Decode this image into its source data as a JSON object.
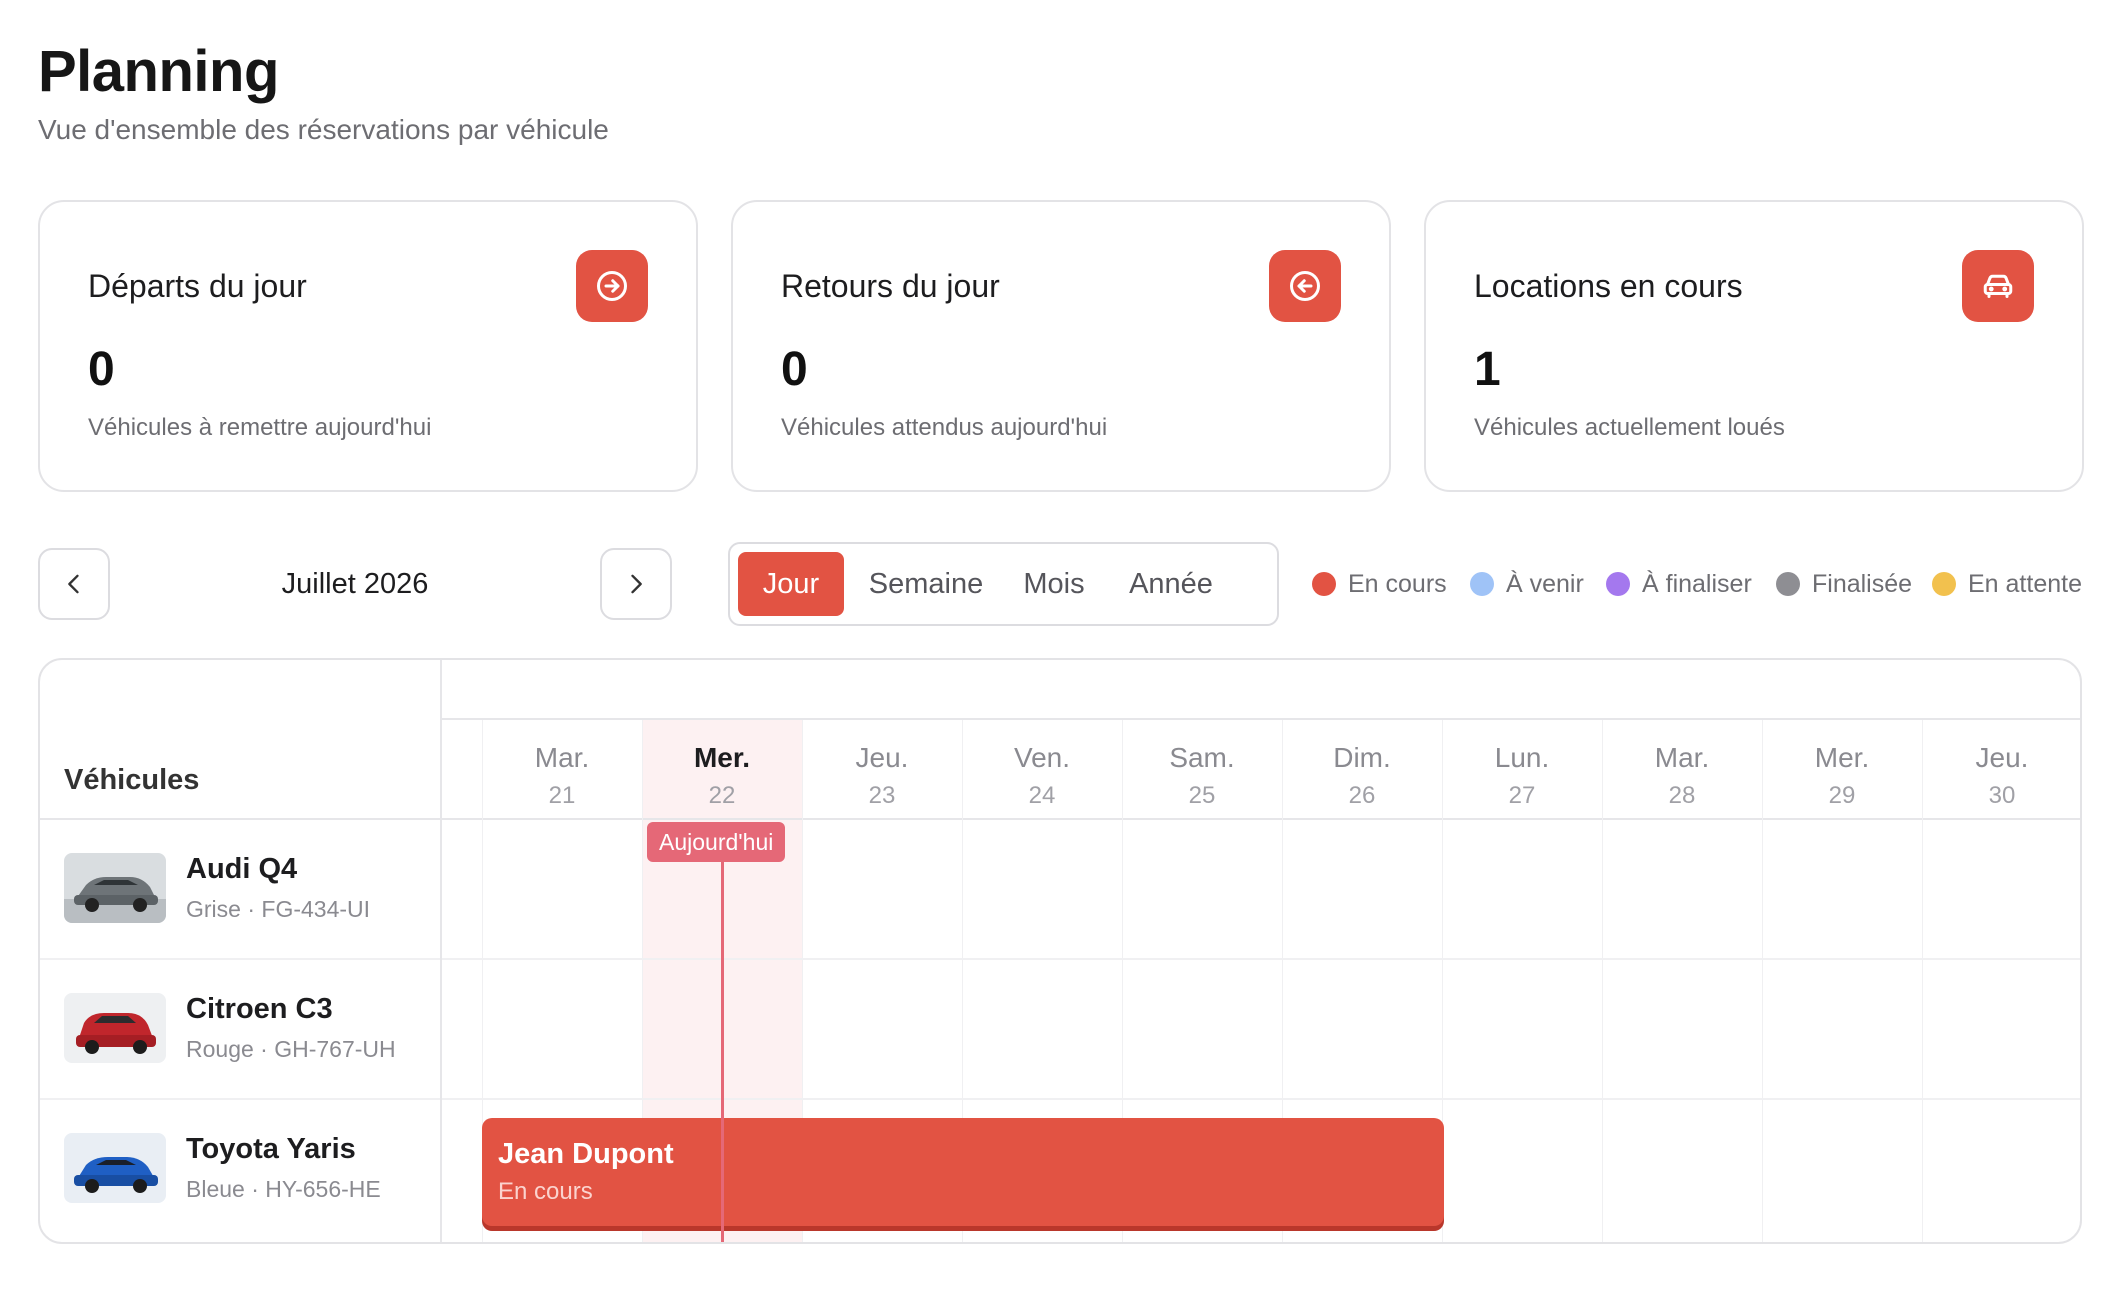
{
  "header": {
    "title": "Planning",
    "subtitle": "Vue d'ensemble des réservations par véhicule"
  },
  "stats": [
    {
      "label": "Départs du jour",
      "value": "0",
      "desc": "Véhicules à remettre aujourd'hui",
      "icon": "arrow-right-circle-icon"
    },
    {
      "label": "Retours du jour",
      "value": "0",
      "desc": "Véhicules attendus aujourd'hui",
      "icon": "arrow-left-circle-icon"
    },
    {
      "label": "Locations en cours",
      "value": "1",
      "desc": "Véhicules actuellement loués",
      "icon": "car-icon"
    }
  ],
  "calendar": {
    "month": "Juillet 2026",
    "views": [
      "Jour",
      "Semaine",
      "Mois",
      "Année"
    ],
    "active_view": "Jour",
    "today_label": "Aujourd'hui"
  },
  "legend": [
    {
      "label": "En cours",
      "color": "#e25343"
    },
    {
      "label": "À venir",
      "color": "#9fc3f7"
    },
    {
      "label": "À finaliser",
      "color": "#a478ee"
    },
    {
      "label": "Finalisée",
      "color": "#8e8e93"
    },
    {
      "label": "En attente",
      "color": "#f2c14e"
    }
  ],
  "grid": {
    "vehicles_header": "Véhicules",
    "days": [
      {
        "name": "Mar.",
        "num": "21"
      },
      {
        "name": "Mer.",
        "num": "22",
        "today": true
      },
      {
        "name": "Jeu.",
        "num": "23"
      },
      {
        "name": "Ven.",
        "num": "24"
      },
      {
        "name": "Sam.",
        "num": "25"
      },
      {
        "name": "Dim.",
        "num": "26"
      },
      {
        "name": "Lun.",
        "num": "27"
      },
      {
        "name": "Mar.",
        "num": "28"
      },
      {
        "name": "Mer.",
        "num": "29"
      },
      {
        "name": "Jeu.",
        "num": "30"
      }
    ],
    "vehicles": [
      {
        "name": "Audi Q4",
        "meta": "Grise · FG-434-UI",
        "color": "#6e7478"
      },
      {
        "name": "Citroen C3",
        "meta": "Rouge · GH-767-UH",
        "color": "#c0262c"
      },
      {
        "name": "Toyota Yaris",
        "meta": "Bleue · HY-656-HE",
        "color": "#1f5fc4"
      }
    ],
    "booking": {
      "client": "Jean Dupont",
      "status": "En cours"
    }
  }
}
